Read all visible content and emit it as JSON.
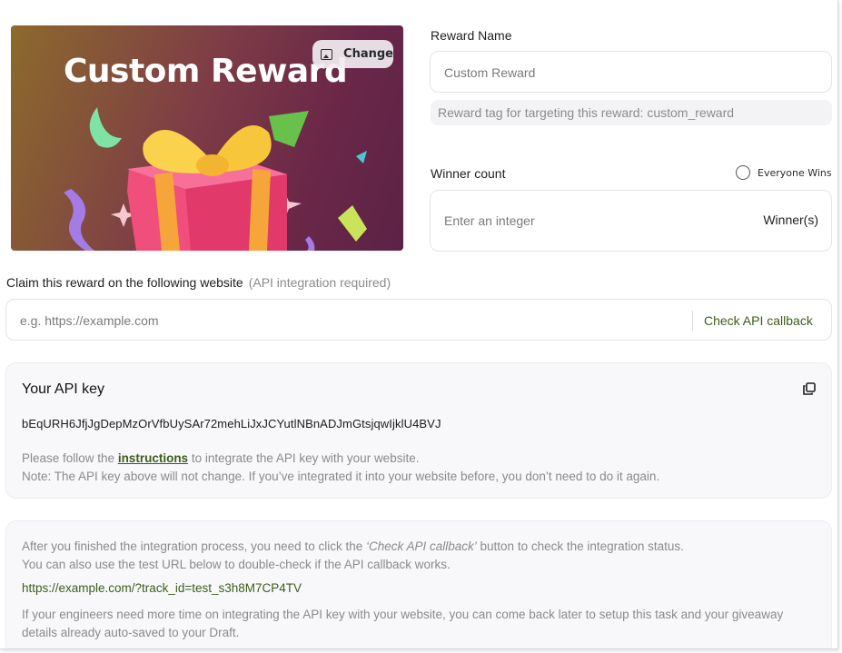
{
  "banner": {
    "title": "Custom Reward",
    "change_label": "Change"
  },
  "reward_name": {
    "label": "Reward Name",
    "value": "Custom Reward",
    "tag_note": "Reward tag for targeting this reward: custom_reward"
  },
  "winner": {
    "label": "Winner count",
    "everyone_wins_label": "Everyone Wins",
    "placeholder": "Enter an integer",
    "suffix": "Winner(s)"
  },
  "claim": {
    "label": "Claim this reward on the following website",
    "hint": "(API integration required)",
    "placeholder": "e.g. https://example.com",
    "check_label": "Check API callback"
  },
  "api_key_card": {
    "title": "Your API key",
    "key": "bEqURH6JfjJgDepMzOrVfbUySAr72mehLiJxJCYutlNBnADJmGtsjqwIjklU4BVJ",
    "note_prefix": "Please follow the ",
    "instructions_link": "instructions",
    "note_suffix": " to integrate the API key with your website.",
    "note_line2": "Note: The API key above will not change. If you’ve integrated it into your website before, you don’t need to do it again."
  },
  "integration_card": {
    "line1_prefix": "After you finished the integration process, you need to click the ",
    "line1_emph": "‘Check API callback’",
    "line1_suffix": " button to check the integration status.",
    "line2": "You can also use the test URL below to double-check if the API callback works.",
    "test_url": "https://example.com/?track_id=test_s3h8M7CP4TV",
    "line3": "If your engineers need more time on integrating the API key with your website, you can come back later to setup this task and your giveaway details already auto-saved to your Draft."
  },
  "colors": {
    "accent_green": "#3e5c17",
    "muted_text": "#8a8a8a",
    "card_bg": "#f8f8fb"
  },
  "icons": {
    "change": "image-icon",
    "copy": "copy-icon",
    "radio": "radio-unchecked-icon"
  }
}
